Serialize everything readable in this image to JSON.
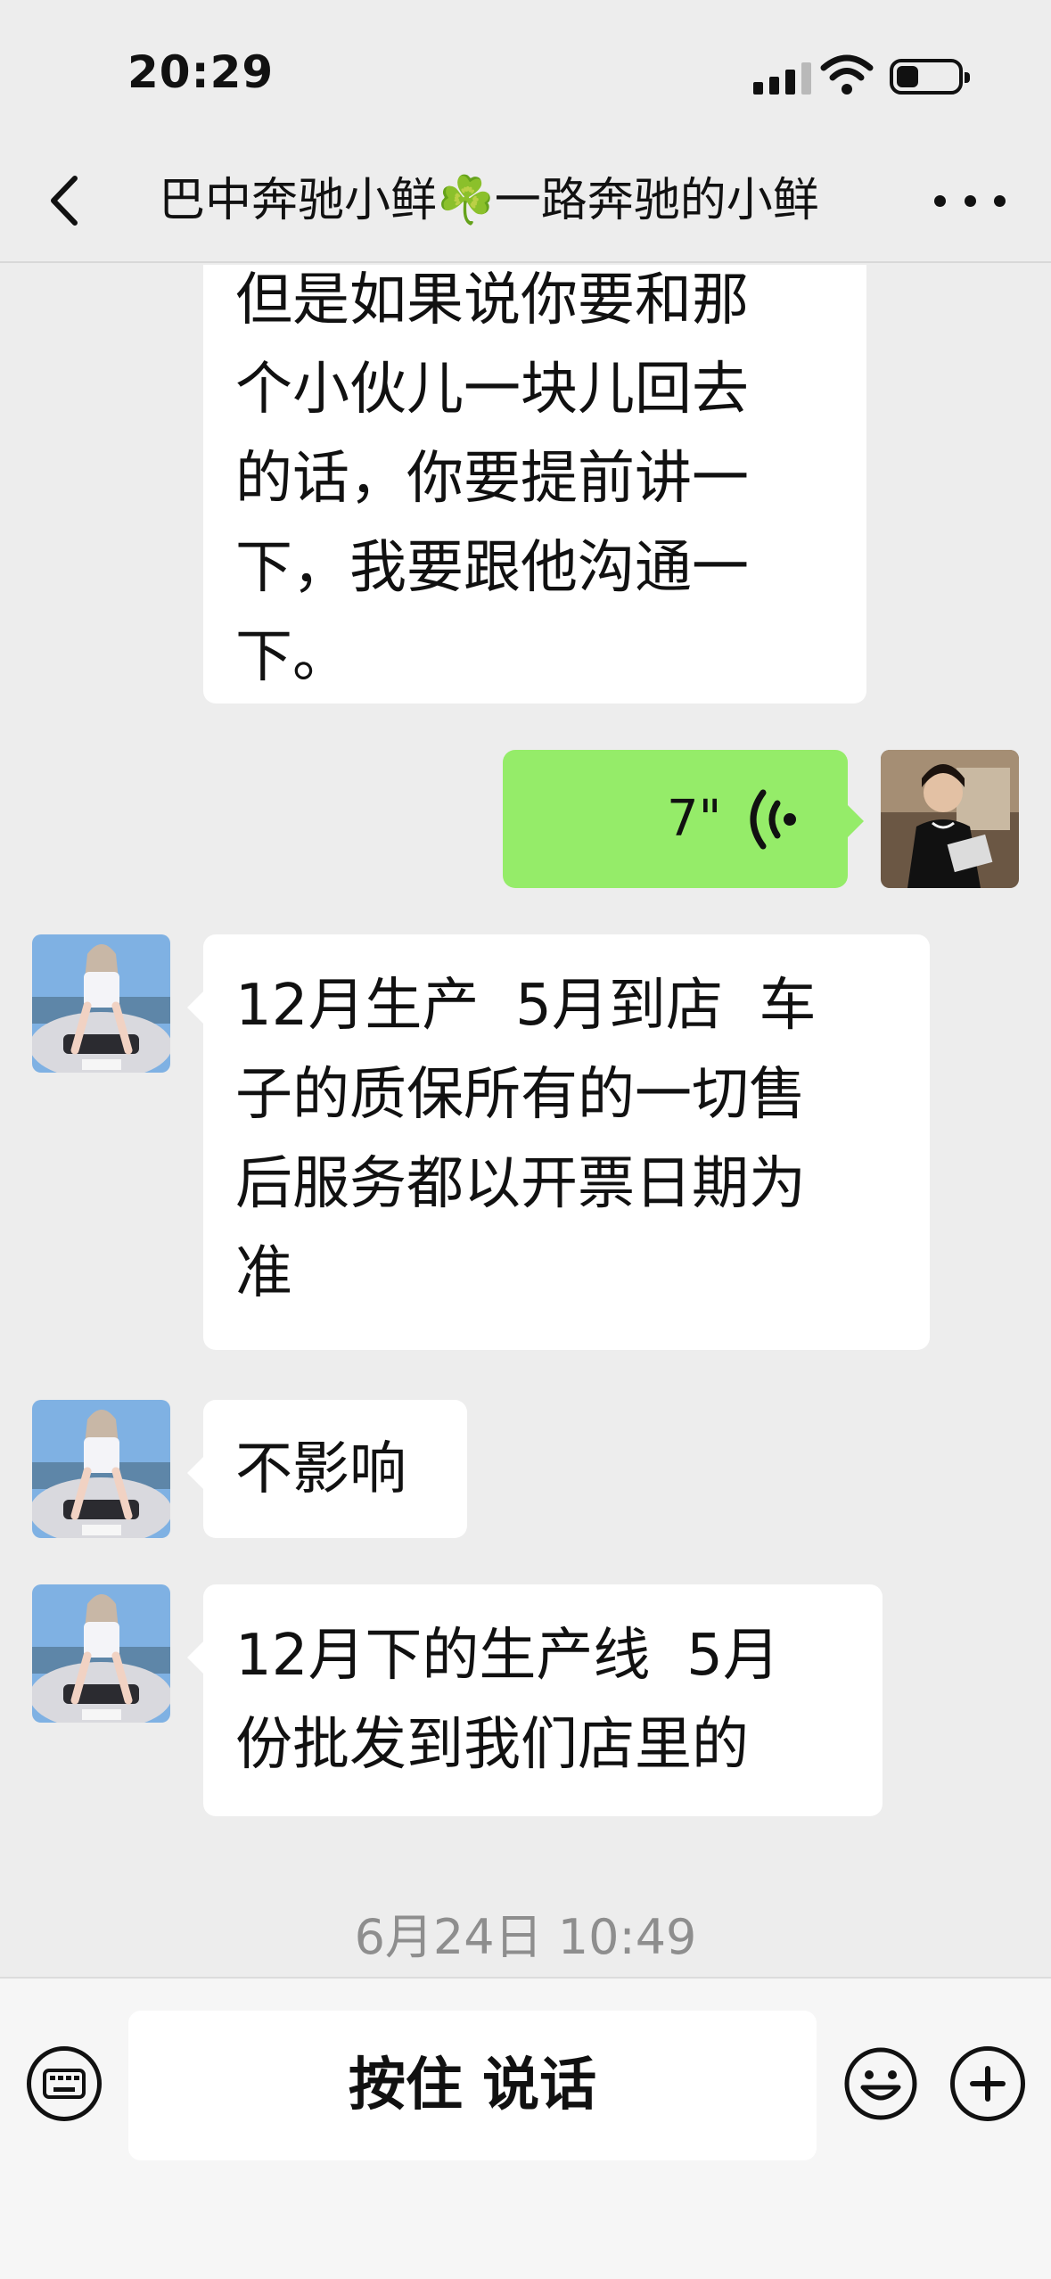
{
  "status_bar": {
    "time": "20:29"
  },
  "header": {
    "title": "巴中奔驰小鲜☘️一路奔驰的小鲜",
    "back_icon": "chevron-left-icon",
    "more_icon": "more-dots-icon"
  },
  "messages": [
    {
      "side": "left",
      "text": "但是如果说你要和那\n个小伙儿一块儿回去\n的话，你要提前讲一\n下，我要跟他沟通一\n下。"
    },
    {
      "side": "right",
      "type": "voice",
      "duration": "7\""
    },
    {
      "side": "left",
      "text": "12月生产  5月到店  车\n子的质保所有的一切售\n后服务都以开票日期为\n准"
    },
    {
      "side": "left",
      "text": "不影响"
    },
    {
      "side": "left",
      "text": "12月下的生产线  5月\n份批发到我们店里的"
    }
  ],
  "timestamp": "6月24日 10:49",
  "input_bar": {
    "hold_to_talk": "按住 说话",
    "keyboard_icon": "keyboard-icon",
    "emoji_icon": "emoji-icon",
    "plus_icon": "plus-icon"
  }
}
